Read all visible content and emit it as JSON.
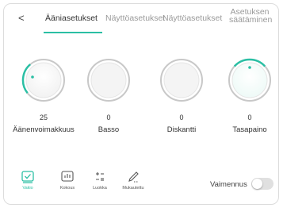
{
  "accent_color": "#2bbfa4",
  "header": {
    "back_icon": "chevron-left-icon",
    "tabs": [
      {
        "label": "Ääniasetukset",
        "active": true
      },
      {
        "label": "Näyttöasetukset",
        "active": false
      },
      {
        "label": "Näyttöasetukset",
        "active": false
      },
      {
        "label_line1": "Asetuksen",
        "label_line2": "säätäminen",
        "active": false
      }
    ]
  },
  "knobs": [
    {
      "value": "25",
      "label": "Äänenvoimakkuus",
      "level_percent": 25
    },
    {
      "value": "0",
      "label": "Basso",
      "level_percent": 0
    },
    {
      "value": "0",
      "label": "Diskantti",
      "level_percent": 0
    },
    {
      "value": "0",
      "label": "Tasapaino",
      "level_percent": 50
    }
  ],
  "modes": [
    {
      "label": "Vakio",
      "icon": "check-square-icon",
      "active": true
    },
    {
      "label": "Kokous",
      "icon": "bar-chart-icon",
      "active": false
    },
    {
      "label": "Luokka",
      "icon": "plus-minus-icon",
      "active": false
    },
    {
      "label": "Mukautettu",
      "icon": "pen-icon",
      "active": false
    }
  ],
  "mute": {
    "label": "Vaimennus",
    "on": false
  }
}
